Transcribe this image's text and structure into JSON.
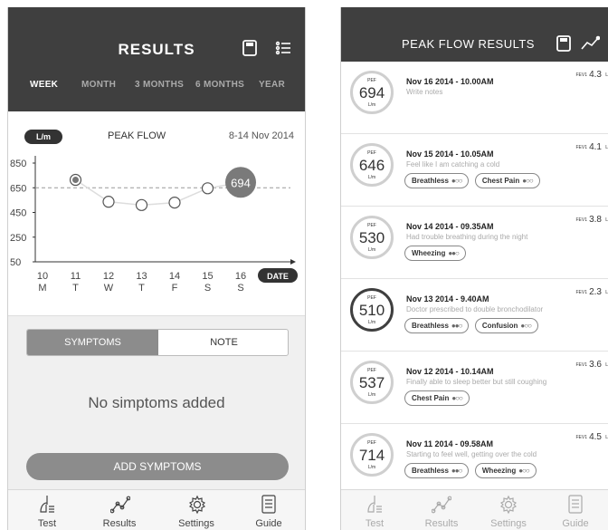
{
  "left": {
    "header": {
      "title": "RESULTS"
    },
    "period_tabs": [
      {
        "label": "WEEK",
        "active": true
      },
      {
        "label": "MONTH",
        "active": false
      },
      {
        "label": "3 MONTHS",
        "active": false
      },
      {
        "label": "6 MONTHS",
        "active": false
      },
      {
        "label": "YEAR",
        "active": false
      }
    ],
    "chart_header": {
      "unit": "L/m",
      "title": "PEAK FLOW",
      "range": "8-14 Nov 2014"
    },
    "chart_data": {
      "type": "line",
      "title": "PEAK FLOW",
      "ylabel": "L/m",
      "xlabel": "DATE",
      "x": [
        "10 M",
        "11 T",
        "12 W",
        "13 T",
        "14 F",
        "15 S",
        "16 S"
      ],
      "day_numbers": [
        "10",
        "11",
        "12",
        "13",
        "14",
        "15",
        "16"
      ],
      "day_letters": [
        "M",
        "T",
        "W",
        "T",
        "F",
        "S",
        "S"
      ],
      "y_ticks": [
        "850",
        "650",
        "450",
        "250",
        "50"
      ],
      "ylim": [
        50,
        850
      ],
      "series": [
        {
          "values": [
            null,
            714,
            537,
            510,
            530,
            646,
            694
          ]
        }
      ],
      "reference_line": 650,
      "highlight_label": "694",
      "axis_label": "DATE"
    },
    "symptoms": {
      "tab_symptoms": "SYMPTOMS",
      "tab_note": "NOTE",
      "empty_message": "No simptoms added",
      "add_button": "ADD SYMPTOMS"
    },
    "nav": [
      {
        "label": "Test",
        "icon": "lungs-icon"
      },
      {
        "label": "Results",
        "icon": "chart-line-icon"
      },
      {
        "label": "Settings",
        "icon": "gear-icon"
      },
      {
        "label": "Guide",
        "icon": "document-icon"
      }
    ]
  },
  "right": {
    "header": {
      "title": "PEAK FLOW RESULTS"
    },
    "ring_pef": "PEF",
    "ring_unit": "L/m",
    "fev_label": "FEV1",
    "fev_unit": "L",
    "entries": [
      {
        "pef": "694",
        "date": "Nov 16 2014 - 10.00AM",
        "note": "Write notes",
        "fev": "4.3",
        "symptoms": []
      },
      {
        "pef": "646",
        "date": "Nov 15 2014 - 10.05AM",
        "note": "Feel like I am catching a cold",
        "fev": "4.1",
        "symptoms": [
          {
            "name": "Breathless",
            "level": "●○○"
          },
          {
            "name": "Chest Pain",
            "level": "●○○"
          }
        ]
      },
      {
        "pef": "530",
        "date": "Nov 14 2014 - 09.35AM",
        "note": "Had trouble breathing during the night",
        "fev": "3.8",
        "symptoms": [
          {
            "name": "Wheezing",
            "level": "●●○"
          }
        ]
      },
      {
        "pef": "510",
        "date": "Nov 13 2014 - 9.40AM",
        "note": "Doctor prescribed to double bronchodilator",
        "fev": "2.3",
        "symptoms": [
          {
            "name": "Breathless",
            "level": "●●○"
          },
          {
            "name": "Confusion",
            "level": "●○○"
          }
        ]
      },
      {
        "pef": "537",
        "date": "Nov 12 2014 - 10.14AM",
        "note": "Finally able to sleep better but still coughing",
        "fev": "3.6",
        "symptoms": [
          {
            "name": "Chest Pain",
            "level": "●○○"
          }
        ]
      },
      {
        "pef": "714",
        "date": "Nov 11 2014 - 09.58AM",
        "note": "Starting to feel well, getting over the cold",
        "fev": "4.5",
        "symptoms": [
          {
            "name": "Breathless",
            "level": "●●○"
          },
          {
            "name": "Wheezing",
            "level": "●○○"
          }
        ]
      }
    ],
    "nav": [
      {
        "label": "Test",
        "icon": "lungs-icon"
      },
      {
        "label": "Results",
        "icon": "chart-line-icon"
      },
      {
        "label": "Settings",
        "icon": "gear-icon"
      },
      {
        "label": "Guide",
        "icon": "document-icon"
      }
    ]
  }
}
